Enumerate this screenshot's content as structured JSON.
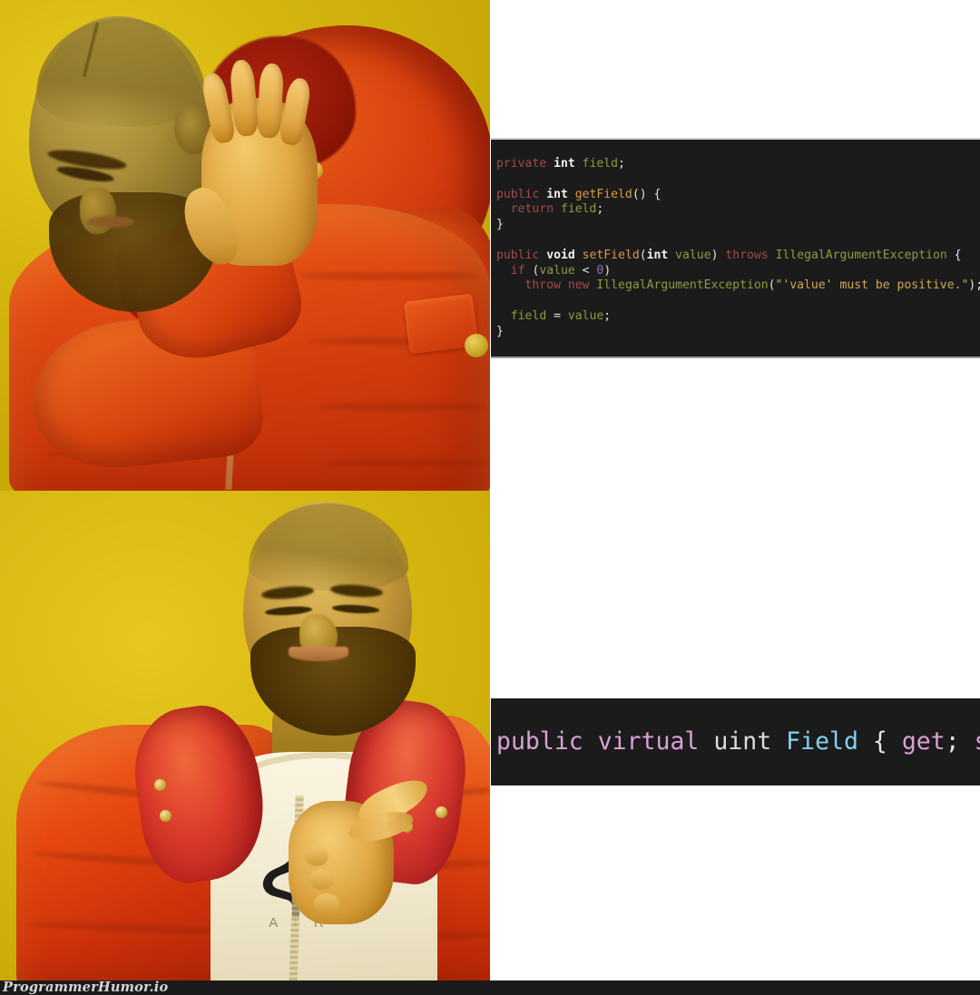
{
  "meme": {
    "format": "drake-hotline-bling-two-panel",
    "watermark": "ProgrammerHumor.io",
    "panels": {
      "top": {
        "reaction": "reject",
        "subject_description": "Drake turning away with raised blocking hand, orange puffer jacket, yellow backdrop",
        "icon": "hand-block-icon"
      },
      "bottom": {
        "reaction": "approve",
        "subject_description": "Drake smiling with approving finger point, orange puffer jacket over white Jordan AIR t-shirt, yellow backdrop",
        "icon": "pointing-hand-icon",
        "shirt_text": "A I R"
      }
    }
  },
  "code_top": {
    "language": "java",
    "lines": [
      {
        "tokens": [
          {
            "t": "private",
            "c": "j-kw"
          },
          {
            "t": " ",
            "c": "j-pun"
          },
          {
            "t": "int",
            "c": "j-type"
          },
          {
            "t": " ",
            "c": "j-pun"
          },
          {
            "t": "field",
            "c": "j-var"
          },
          {
            "t": ";",
            "c": "j-pun"
          }
        ]
      },
      {
        "tokens": []
      },
      {
        "tokens": [
          {
            "t": "public",
            "c": "j-kw"
          },
          {
            "t": " ",
            "c": "j-pun"
          },
          {
            "t": "int",
            "c": "j-type"
          },
          {
            "t": " ",
            "c": "j-pun"
          },
          {
            "t": "getField",
            "c": "j-fn"
          },
          {
            "t": "() {",
            "c": "j-pun"
          }
        ]
      },
      {
        "tokens": [
          {
            "t": "  ",
            "c": "j-pun"
          },
          {
            "t": "return",
            "c": "j-kw"
          },
          {
            "t": " ",
            "c": "j-pun"
          },
          {
            "t": "field",
            "c": "j-var"
          },
          {
            "t": ";",
            "c": "j-pun"
          }
        ]
      },
      {
        "tokens": [
          {
            "t": "}",
            "c": "j-pun"
          }
        ]
      },
      {
        "tokens": []
      },
      {
        "tokens": [
          {
            "t": "public",
            "c": "j-kw"
          },
          {
            "t": " ",
            "c": "j-pun"
          },
          {
            "t": "void",
            "c": "j-type"
          },
          {
            "t": " ",
            "c": "j-pun"
          },
          {
            "t": "setField",
            "c": "j-fn"
          },
          {
            "t": "(",
            "c": "j-pun"
          },
          {
            "t": "int",
            "c": "j-type"
          },
          {
            "t": " ",
            "c": "j-pun"
          },
          {
            "t": "value",
            "c": "j-var"
          },
          {
            "t": ") ",
            "c": "j-pun"
          },
          {
            "t": "throws",
            "c": "j-kw"
          },
          {
            "t": " ",
            "c": "j-pun"
          },
          {
            "t": "IllegalArgumentException",
            "c": "j-var"
          },
          {
            "t": " {",
            "c": "j-pun"
          }
        ]
      },
      {
        "tokens": [
          {
            "t": "  ",
            "c": "j-pun"
          },
          {
            "t": "if",
            "c": "j-kw"
          },
          {
            "t": " (",
            "c": "j-pun"
          },
          {
            "t": "value",
            "c": "j-var"
          },
          {
            "t": " < ",
            "c": "j-pun"
          },
          {
            "t": "0",
            "c": "j-num"
          },
          {
            "t": ")",
            "c": "j-pun"
          }
        ]
      },
      {
        "tokens": [
          {
            "t": "    ",
            "c": "j-pun"
          },
          {
            "t": "throw",
            "c": "j-kw"
          },
          {
            "t": " ",
            "c": "j-pun"
          },
          {
            "t": "new",
            "c": "j-kw"
          },
          {
            "t": " ",
            "c": "j-pun"
          },
          {
            "t": "IllegalArgumentException",
            "c": "j-var"
          },
          {
            "t": "(",
            "c": "j-pun"
          },
          {
            "t": "\"'value' must be positive.\"",
            "c": "j-str"
          },
          {
            "t": ");",
            "c": "j-pun"
          }
        ]
      },
      {
        "tokens": []
      },
      {
        "tokens": [
          {
            "t": "  ",
            "c": "j-pun"
          },
          {
            "t": "field",
            "c": "j-var"
          },
          {
            "t": " = ",
            "c": "j-pun"
          },
          {
            "t": "value",
            "c": "j-var"
          },
          {
            "t": ";",
            "c": "j-pun"
          }
        ]
      },
      {
        "tokens": [
          {
            "t": "}",
            "c": "j-pun"
          }
        ]
      }
    ],
    "plain_text": "private int field;\n\npublic int getField() {\n  return field;\n}\n\npublic void setField(int value) throws IllegalArgumentException {\n  if (value < 0)\n    throw new IllegalArgumentException(\"'value' must be positive.\");\n\n  field = value;\n}"
  },
  "code_bottom": {
    "language": "csharp",
    "lines": [
      {
        "tokens": [
          {
            "t": "public",
            "c": "c-kw"
          },
          {
            "t": " ",
            "c": "c-pun"
          },
          {
            "t": "virtual",
            "c": "c-kw"
          },
          {
            "t": " ",
            "c": "c-pun"
          },
          {
            "t": "uint",
            "c": "c-type"
          },
          {
            "t": " ",
            "c": "c-pun"
          },
          {
            "t": "Field",
            "c": "c-prop"
          },
          {
            "t": " { ",
            "c": "c-pun"
          },
          {
            "t": "get",
            "c": "c-kw"
          },
          {
            "t": "; ",
            "c": "c-pun"
          },
          {
            "t": "set",
            "c": "c-kw"
          },
          {
            "t": "; }",
            "c": "c-pun"
          }
        ]
      }
    ],
    "plain_text": "public virtual uint Field { get; set; }"
  },
  "colors": {
    "code_background": "#1b1b1b",
    "page_background": "#ffffff",
    "backdrop_yellow": "#d6b810",
    "jacket_orange": "#e2480f",
    "java_keyword": "#a54a4a",
    "java_variable": "#8f9a3e",
    "java_function": "#d99a45",
    "java_string": "#cfa94f",
    "java_number": "#9c6ab5",
    "csharp_keyword": "#d9a0d6",
    "csharp_property": "#82d2f2",
    "watermark_bar": "#1b1b1b",
    "watermark_text": "#d6d6d6"
  }
}
